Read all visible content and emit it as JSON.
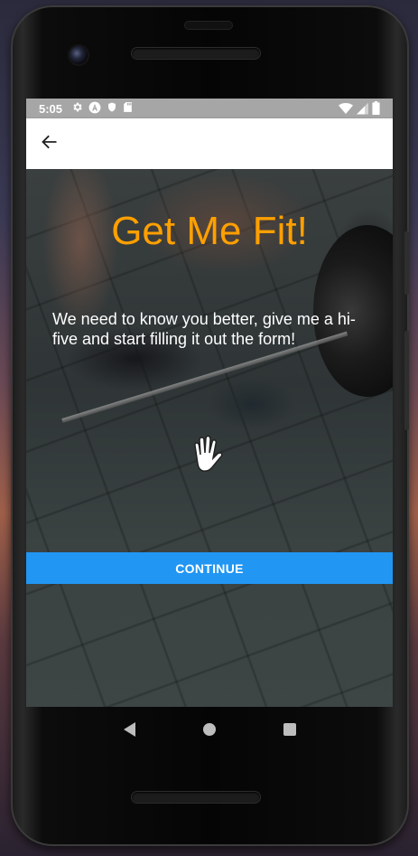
{
  "status_bar": {
    "time": "5:05",
    "left_icons": [
      "gear-icon",
      "android-auto-icon",
      "shield-icon",
      "sd-card-icon"
    ],
    "right_icons": [
      "wifi-icon",
      "signal-icon",
      "battery-icon"
    ]
  },
  "app_bar": {
    "back_icon": "arrow-back-icon"
  },
  "main": {
    "title": "Get Me Fit!",
    "description": "We need to know you better, give me a hi-five and start filling it out the form!",
    "hand_icon": "hi-five-hand-icon",
    "continue_label": "CONTINUE"
  },
  "colors": {
    "title": "#ffa000",
    "button": "#2196f3",
    "status_bar": "#a6a6a6"
  },
  "nav_bar": {
    "icons": [
      "nav-back-icon",
      "nav-home-icon",
      "nav-recents-icon"
    ]
  }
}
